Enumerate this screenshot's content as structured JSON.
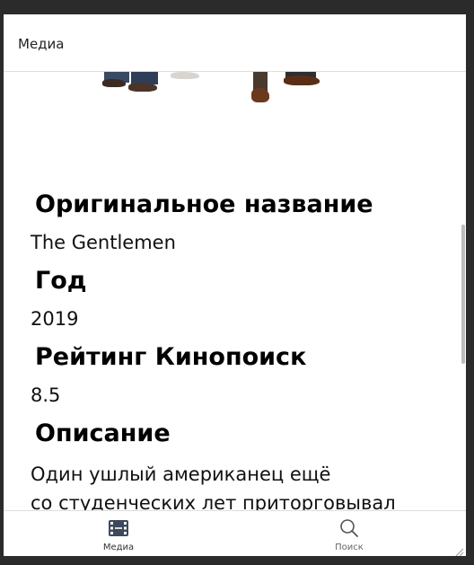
{
  "header": {
    "title": "Медиа"
  },
  "details": {
    "original_title_label": "Оригинальное название",
    "original_title_value": "The Gentlemen",
    "year_label": "Год",
    "year_value": "2019",
    "rating_label": "Рейтинг Кинопоиск",
    "rating_value": "8.5",
    "description_label": "Описание",
    "description_line1": "Один ушлый американец ещё",
    "description_line2": "со студенческих лет приторговывал"
  },
  "bottom_nav": {
    "media_label": "Медиа",
    "search_label": "Поиск"
  },
  "icons": {
    "media": "film-icon",
    "search": "search-icon"
  },
  "colors": {
    "accent": "#3d4a5c"
  }
}
